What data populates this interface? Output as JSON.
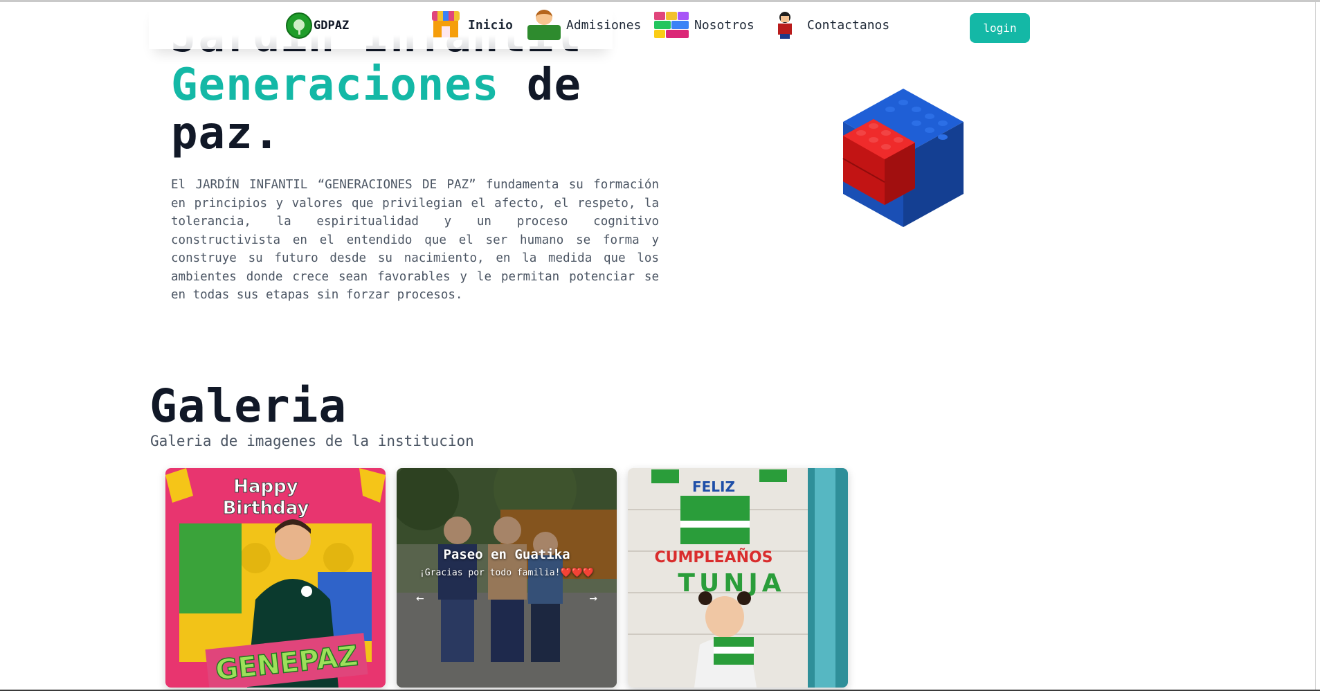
{
  "navbar": {
    "brand": "GDPAZ",
    "items": [
      {
        "label": "Inicio",
        "icon": "house-blocks-icon",
        "active": true
      },
      {
        "label": "Admisiones",
        "icon": "kid-icon",
        "active": false
      },
      {
        "label": "Nosotros",
        "icon": "blocks-icon",
        "active": false
      },
      {
        "label": "Contactanos",
        "icon": "person-icon",
        "active": false
      }
    ],
    "login_label": "login"
  },
  "hero": {
    "title_line1": "Jardín Infantil",
    "title_highlight": "Generaciones",
    "title_line2_rest": " de",
    "title_line3": "paz.",
    "description": "El JARDÍN INFANTIL “GENERACIONES DE PAZ” fundamenta su formación en principios y valores que privilegian el afecto, el respeto, la tolerancia, la espiritualidad y un proceso cognitivo constructivista en el entendido que el ser humano se forma y construye su futuro desde su nacimiento, en la medida que los ambientes donde crece sean favorables y le permitan potenciar se en todas sus etapas sin forzar procesos."
  },
  "gallery": {
    "title": "Galeria",
    "subtitle": "Galeria de imagenes de la institucion",
    "carousel": {
      "title": "Paseo en Guatika",
      "text": "¡Gracias por todo familia!❤️❤️❤️",
      "prev": "←",
      "next": "→"
    },
    "photos": [
      {
        "text_top": "Happy",
        "text_mid": "Birthday",
        "banner": "GENEPAZ"
      },
      {},
      {
        "line1": "FELIZ",
        "line2": "CUMPLEAÑOS",
        "line3": "TUNJA"
      }
    ]
  },
  "colors": {
    "accent": "#14b8a6",
    "text": "#111827",
    "muted": "#4b5563"
  }
}
